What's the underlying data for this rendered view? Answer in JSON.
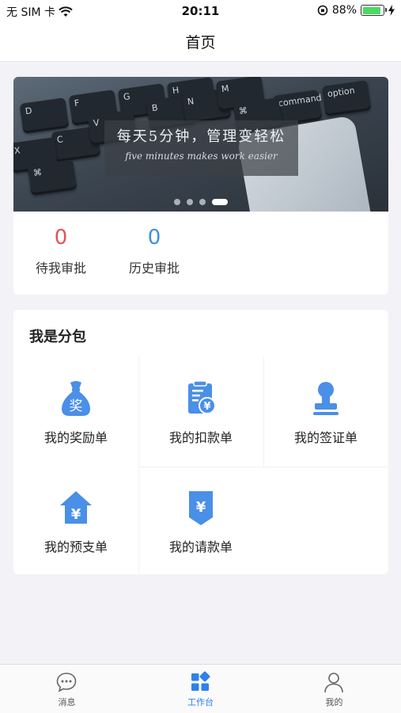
{
  "status_bar": {
    "carrier": "无 SIM 卡",
    "time": "20:11",
    "battery": "88%"
  },
  "nav": {
    "title": "首页"
  },
  "banner": {
    "title": "每天5分钟，管理变轻松",
    "subtitle": "five minutes makes work easier",
    "keys": [
      "D",
      "F",
      "G",
      "H",
      "B",
      "N",
      "M",
      "C",
      "V",
      "X",
      "⌘",
      "command",
      "option",
      "⌘"
    ],
    "page_count": 4,
    "active_page": 4
  },
  "stats": [
    {
      "value": "0",
      "label": "待我审批",
      "color": "#e25555"
    },
    {
      "value": "0",
      "label": "历史审批",
      "color": "#3d8fe4"
    }
  ],
  "subcontract": {
    "title": "我是分包",
    "items": [
      {
        "label": "我的奖励单",
        "icon": "money-bag-icon",
        "glyph": "奖"
      },
      {
        "label": "我的扣款单",
        "icon": "deduction-doc-icon",
        "glyph": "¥"
      },
      {
        "label": "我的签证单",
        "icon": "stamp-icon",
        "glyph": ""
      },
      {
        "label": "我的预支单",
        "icon": "house-yen-icon",
        "glyph": "¥"
      },
      {
        "label": "我的请款单",
        "icon": "yen-doc-icon",
        "glyph": "¥"
      }
    ]
  },
  "tabs": [
    {
      "label": "消息",
      "icon": "chat-bubble-icon",
      "active": false
    },
    {
      "label": "工作台",
      "icon": "grid-icon",
      "active": true
    },
    {
      "label": "我的",
      "icon": "person-icon",
      "active": false
    }
  ],
  "colors": {
    "accent": "#2f80ed",
    "icon_blue": "#4a8fe8",
    "pending_red": "#e25555",
    "history_blue": "#3d8fe4"
  }
}
